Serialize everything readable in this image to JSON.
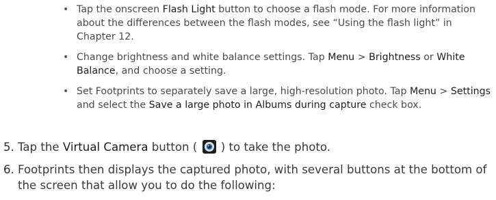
{
  "bullets": [
    {
      "segments": [
        {
          "text": "Tap the onscreen ",
          "term": false
        },
        {
          "text": "Flash Light",
          "term": true
        },
        {
          "text": " button to choose a flash mode. For more information about the differences between the flash modes, see “Using the flash light” in Chapter 12.",
          "term": false
        }
      ]
    },
    {
      "segments": [
        {
          "text": "Change brightness and white balance settings. Tap ",
          "term": false
        },
        {
          "text": "Menu",
          "term": true
        },
        {
          "text": " > ",
          "term": false
        },
        {
          "text": "Brightness",
          "term": true
        },
        {
          "text": " or ",
          "term": false
        },
        {
          "text": "White Balance",
          "term": true
        },
        {
          "text": ", and choose a setting.",
          "term": false
        }
      ]
    },
    {
      "segments": [
        {
          "text": "Set Footprints to separately save a large, high-resolution photo. Tap ",
          "term": false
        },
        {
          "text": "Menu",
          "term": true
        },
        {
          "text": " > ",
          "term": false
        },
        {
          "text": "Settings",
          "term": true
        },
        {
          "text": " and select the ",
          "term": false
        },
        {
          "text": "Save a large photo in Albums during capture",
          "term": true
        },
        {
          "text": " check box.",
          "term": false
        }
      ]
    }
  ],
  "steps": [
    {
      "number": "5.",
      "before": "Tap the ",
      "term": "Virtual Camera",
      "middle": " button ( ",
      "icon": "camera-shutter-icon",
      "after": " ) to take the photo."
    },
    {
      "number": "6.",
      "text": "Footprints then displays the captured photo, with several buttons at the bottom of the screen that allow you to do the following:"
    }
  ]
}
